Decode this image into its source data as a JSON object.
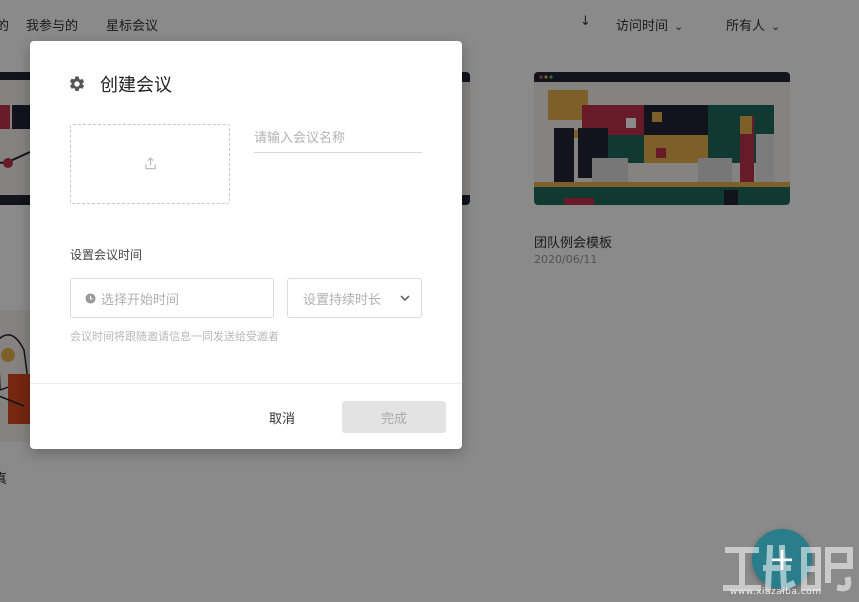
{
  "nav": {
    "partial_item": "的",
    "participated": "我参与的",
    "starred": "星标会议",
    "sort_label": "访问时间",
    "owner_label": "所有人"
  },
  "cards": [
    {
      "title": "团队例会模板",
      "date": "2020/06/11"
    },
    {
      "title": "真",
      "date": ""
    }
  ],
  "modal": {
    "title": "创建会议",
    "name_placeholder": "请输入会议名称",
    "time_section_label": "设置会议时间",
    "start_time_placeholder": "选择开始时间",
    "duration_placeholder": "设置持续时长",
    "hint": "会议时间将跟随邀请信息一同发送给受邀者",
    "cancel_label": "取消",
    "done_label": "完成"
  },
  "fab": {
    "icon": "plus-icon"
  },
  "watermark": {
    "url": "www.xiazaiba.com"
  },
  "colors": {
    "overlay": "rgba(0,0,0,0.46)",
    "fab": "#2a7d8a",
    "done_disabled_bg": "#e3e3e3"
  }
}
